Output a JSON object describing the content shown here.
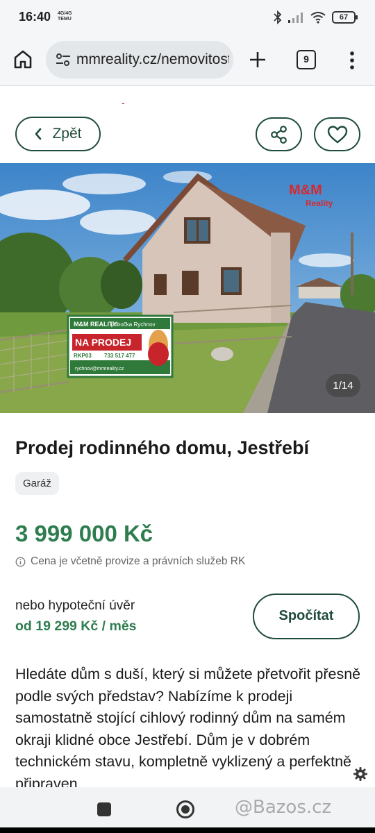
{
  "status_bar": {
    "time": "16:40",
    "carrier_line1": "4G/4G",
    "carrier_line2": "TEMU",
    "battery": "67"
  },
  "browser": {
    "url": "mmreality.cz/nemovitosti",
    "tab_count": "9"
  },
  "header": {
    "back_label": "Zpět"
  },
  "gallery": {
    "counter": "1/14",
    "sign_brand": "M&M REALITY",
    "sign_branch": "pobočka Rychnov",
    "sign_text": "NA PRODEJ",
    "sign_code": "RKP03",
    "sign_phone": "733 517 477",
    "sign_email": "rychnov@mmreality.cz",
    "logo_main": "M&M",
    "logo_sub": "Reality"
  },
  "listing": {
    "title": "Prodej rodinného domu, Jestřebí",
    "tag": "Garáž",
    "price": "3 999 000 Kč",
    "price_note": "Cena je včetně provize a právních služeb RK",
    "mortgage_label": "nebo hypoteční úvěr",
    "mortgage_value": "od 19 299 Kč / měs",
    "calc_label": "Spočítat",
    "description": "Hledáte dům s duší, který si můžete přetvořit přesně podle svých představ? Nabízíme k prodeji samostatně stojící cihlový rodinný dům na samém okraji klidné obce Jestřebí. Dům je v dobrém technickém stavu, kompletně vyklizený a perfektně připraven"
  },
  "watermark": "@Bazos.cz",
  "colors": {
    "accent_green": "#2e7d4f",
    "button_border": "#1f4d3a",
    "brand_red": "#d8282f"
  }
}
